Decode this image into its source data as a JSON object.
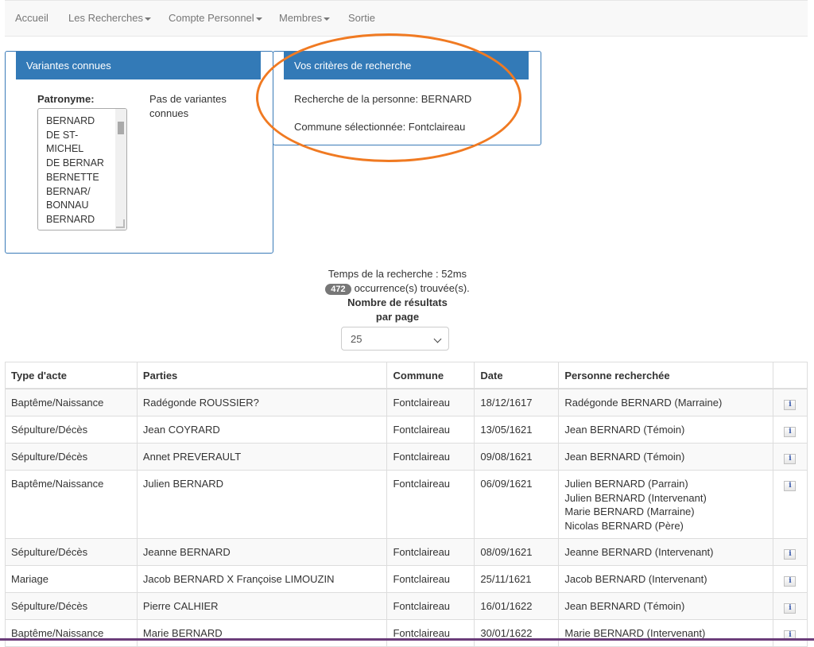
{
  "nav": {
    "items": [
      "Accueil",
      "Les Recherches",
      "Compte Personnel",
      "Membres",
      "Sortie"
    ]
  },
  "variants_panel": {
    "title": "Variantes connues",
    "label": "Patronyme:",
    "listbox_items": [
      "BERNARD",
      "DE ST-",
      "MICHEL",
      "DE BERNAR",
      "BERNETTE",
      "BERNAR/",
      "BONNAU",
      "BERNARD"
    ],
    "no_variants_line1": "Pas de variantes",
    "no_variants_line2": "connues"
  },
  "criteria_panel": {
    "title": "Vos critères de recherche",
    "person_line": "Recherche de la personne: BERNARD",
    "commune_line": "Commune sélectionnée: Fontclaireau"
  },
  "search_info": {
    "time_text": "Temps de la recherche : 52ms",
    "count": "472",
    "occurrences_text": "occurrence(s) trouvée(s).",
    "per_page_label_line1": "Nombre de résultats",
    "per_page_label_line2": "par page",
    "per_page_value": "25"
  },
  "accent_color": "#337ab7",
  "highlight_color": "#f07a22",
  "table": {
    "headers": [
      "Type d'acte",
      "Parties",
      "Commune",
      "Date",
      "Personne recherchée",
      ""
    ],
    "rows": [
      {
        "type": "Baptême/Naissance",
        "parties": "Radégonde ROUSSIER?",
        "commune": "Fontclaireau",
        "date": "18/12/1617",
        "persons": [
          "Radégonde BERNARD (Marraine)"
        ]
      },
      {
        "type": "Sépulture/Décès",
        "parties": "Jean COYRARD",
        "commune": "Fontclaireau",
        "date": "13/05/1621",
        "persons": [
          "Jean BERNARD (Témoin)"
        ]
      },
      {
        "type": "Sépulture/Décès",
        "parties": "Annet PREVERAULT",
        "commune": "Fontclaireau",
        "date": "09/08/1621",
        "persons": [
          "Jean BERNARD (Témoin)"
        ]
      },
      {
        "type": "Baptême/Naissance",
        "parties": "Julien BERNARD",
        "commune": "Fontclaireau",
        "date": "06/09/1621",
        "persons": [
          "Julien BERNARD (Parrain)",
          "Julien BERNARD (Intervenant)",
          "Marie BERNARD (Marraine)",
          "Nicolas BERNARD (Père)"
        ]
      },
      {
        "type": "Sépulture/Décès",
        "parties": "Jeanne BERNARD",
        "commune": "Fontclaireau",
        "date": "08/09/1621",
        "persons": [
          "Jeanne BERNARD (Intervenant)"
        ]
      },
      {
        "type": "Mariage",
        "parties": "Jacob BERNARD X Françoise LIMOUZIN",
        "commune": "Fontclaireau",
        "date": "25/11/1621",
        "persons": [
          "Jacob BERNARD (Intervenant)"
        ]
      },
      {
        "type": "Sépulture/Décès",
        "parties": "Pierre CALHIER",
        "commune": "Fontclaireau",
        "date": "16/01/1622",
        "persons": [
          "Jean BERNARD (Témoin)"
        ]
      },
      {
        "type": "Baptême/Naissance",
        "parties": "Marie BERNARD",
        "commune": "Fontclaireau",
        "date": "30/01/1622",
        "persons": [
          "Marie BERNARD (Intervenant)"
        ]
      }
    ]
  }
}
